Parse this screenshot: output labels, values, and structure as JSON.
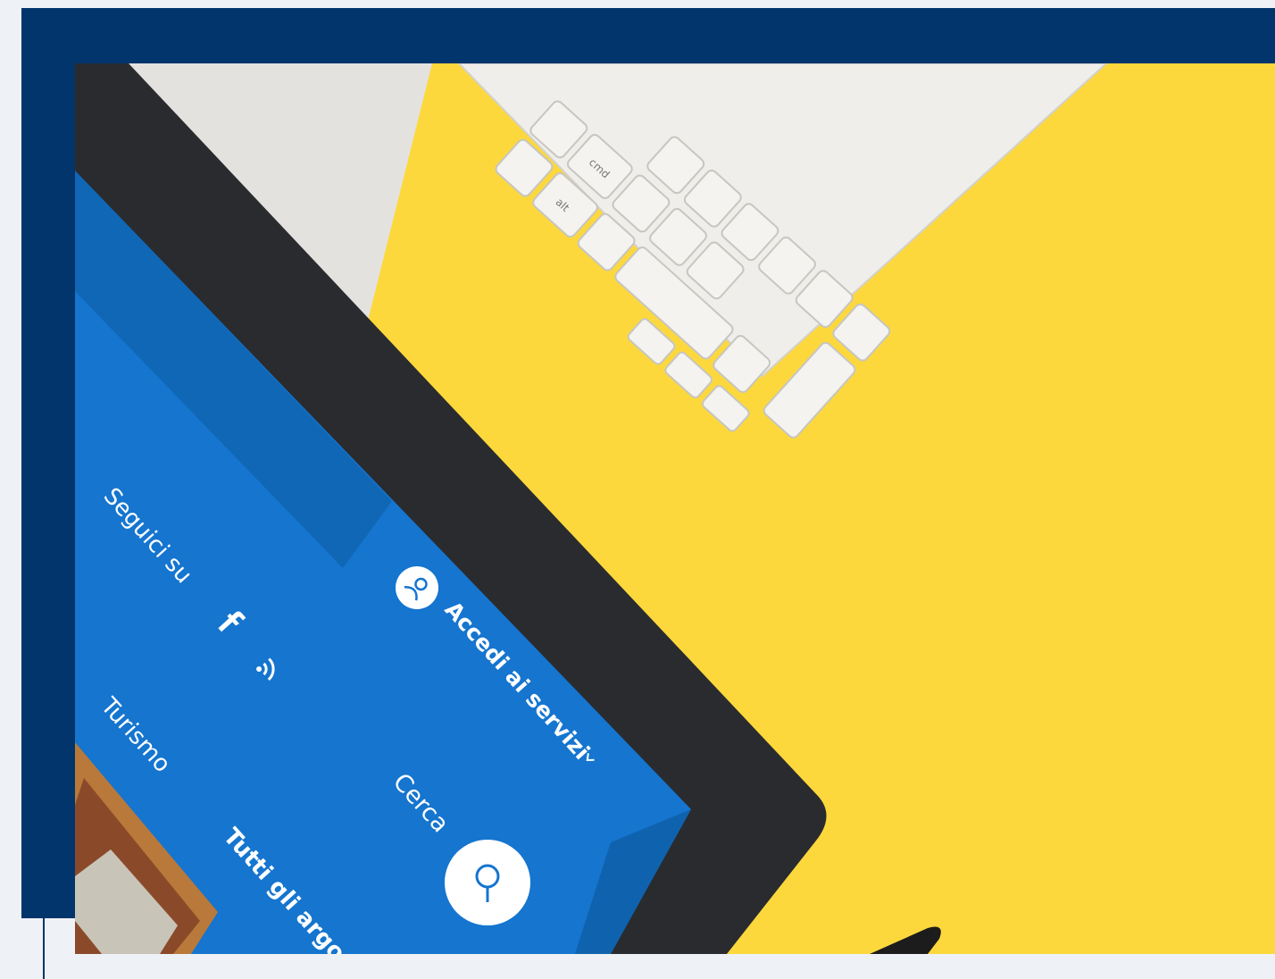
{
  "colors": {
    "frame": "#01356b",
    "page": "#eef1f5",
    "desk_yellow": "#fcd83c",
    "wall_grey": "#e4e2df",
    "tablet_bezel": "#2a2b2e",
    "header_blue": "#1575cf",
    "header_blue_dark": "#0f63ae",
    "keyboard": "#f4f3ef"
  },
  "tablet_screen": {
    "follow_label": "Seguici su",
    "social_icons": [
      "facebook-icon",
      "rss-icon"
    ],
    "menu_item_turismo": "Turismo",
    "menu_item_topics": "Tutti gli argom",
    "login_label": "Accedi ai servizi",
    "login_icon": "user-icon",
    "login_chevron_icon": "chevron-down-icon",
    "search_label": "Cerca",
    "search_icon": "search-icon"
  },
  "keyboard_keys": {
    "cmd": "cmd",
    "alt": "alt"
  }
}
